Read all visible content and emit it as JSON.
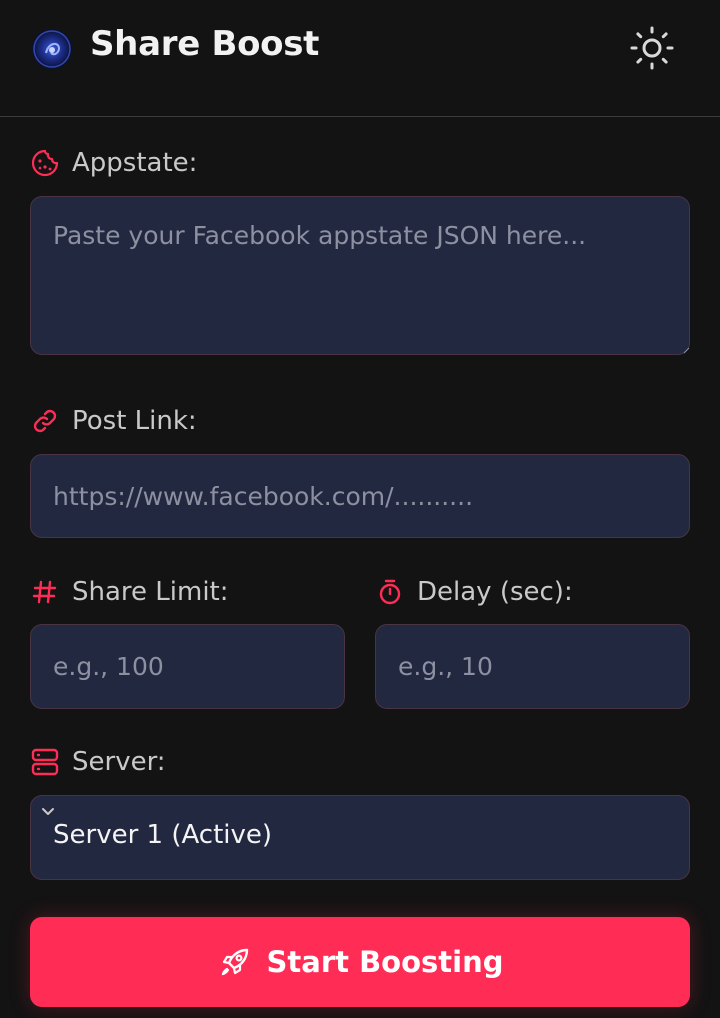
{
  "header": {
    "title": "Share Boost",
    "logo_icon": "galaxy-logo",
    "theme_icon": "sun-icon"
  },
  "form": {
    "appstate": {
      "label": "Appstate:",
      "icon": "cookie-icon",
      "placeholder": "Paste your Facebook appstate JSON here...",
      "value": ""
    },
    "post_link": {
      "label": "Post Link:",
      "icon": "link-icon",
      "placeholder": "https://www.facebook.com/..........",
      "value": ""
    },
    "share_limit": {
      "label": "Share Limit:",
      "icon": "hash-icon",
      "placeholder": "e.g., 100",
      "value": ""
    },
    "delay": {
      "label": "Delay (sec):",
      "icon": "stopwatch-icon",
      "placeholder": "e.g., 10",
      "value": ""
    },
    "server": {
      "label": "Server:",
      "icon": "server-icon",
      "selected": "Server 1 (Active)"
    },
    "submit": {
      "label": "Start Boosting",
      "icon": "rocket-icon"
    }
  },
  "colors": {
    "accent": "#ff2d55",
    "background": "#131313",
    "field_bg": "#232841",
    "field_border": "#4a3342"
  }
}
